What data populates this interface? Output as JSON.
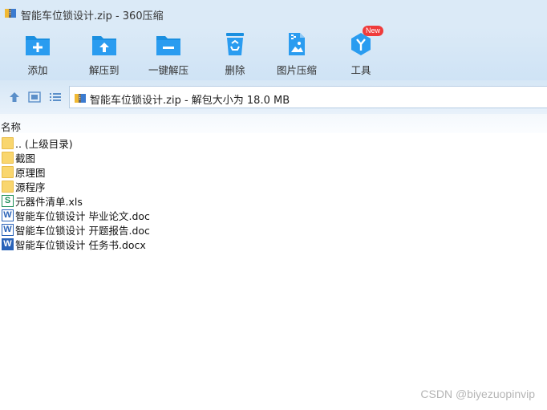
{
  "window": {
    "title": "智能车位锁设计.zip - 360压缩"
  },
  "toolbar": {
    "items": [
      {
        "label": "添加",
        "icon": "add-folder-icon"
      },
      {
        "label": "解压到",
        "icon": "extract-to-icon"
      },
      {
        "label": "一键解压",
        "icon": "one-click-extract-icon"
      },
      {
        "label": "删除",
        "icon": "delete-icon"
      },
      {
        "label": "图片压缩",
        "icon": "image-compress-icon"
      },
      {
        "label": "工具",
        "icon": "tools-icon"
      }
    ],
    "new_badge": "New"
  },
  "address": {
    "text": "智能车位锁设计.zip - 解包大小为 18.0 MB"
  },
  "list": {
    "column_name": "名称",
    "files": [
      {
        "name": ".. (上级目录)",
        "type": "folder"
      },
      {
        "name": "截图",
        "type": "folder"
      },
      {
        "name": "原理图",
        "type": "folder"
      },
      {
        "name": "源程序",
        "type": "folder"
      },
      {
        "name": "元器件清单.xls",
        "type": "xls"
      },
      {
        "name": "智能车位锁设计 毕业论文.doc",
        "type": "doc"
      },
      {
        "name": "智能车位锁设计 开题报告.doc",
        "type": "doc"
      },
      {
        "name": "智能车位锁设计 任务书.docx",
        "type": "docx"
      }
    ]
  },
  "watermark": "CSDN @biyezuopinvip",
  "colors": {
    "accent_blue": "#1a8fe0",
    "badge_red": "#ef3b3b",
    "folder_yellow": "#f9d66e"
  }
}
